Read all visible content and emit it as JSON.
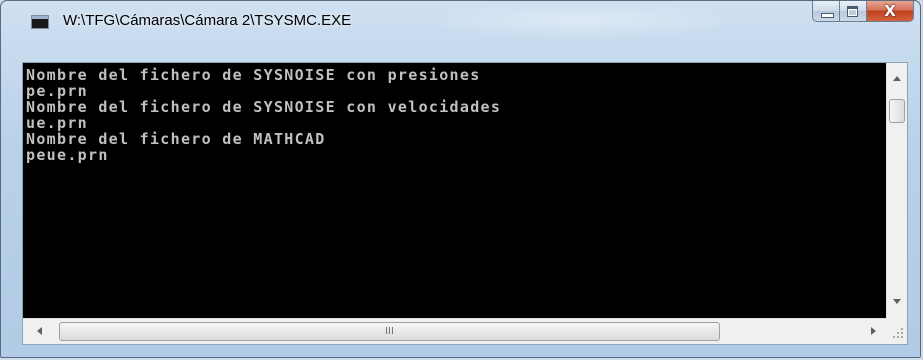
{
  "window": {
    "title": "W:\\TFG\\Cámaras\\Cámara 2\\TSYSMC.EXE",
    "accent_close": "#c2401f",
    "frame_color": "#b9d1ea"
  },
  "caption_buttons": {
    "minimize_icon": "minimize-icon",
    "maximize_icon": "maximize-icon",
    "close_label": "X"
  },
  "console": {
    "background": "#000000",
    "text_color": "#c0c0c0",
    "lines": [
      "Nombre del fichero de SYSNOISE con presiones",
      "pe.prn",
      "Nombre del fichero de SYSNOISE con velocidades",
      "ue.prn",
      "Nombre del fichero de MATHCAD",
      "peue.prn"
    ]
  },
  "scrollbars": {
    "horizontal_grip": "III"
  }
}
